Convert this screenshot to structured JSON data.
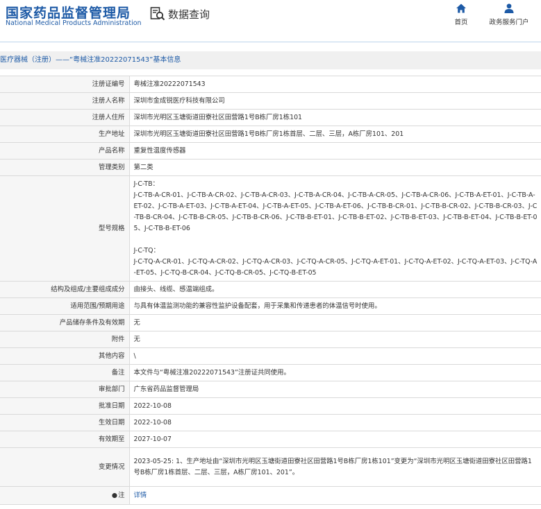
{
  "header": {
    "org_name_cn": "国家药品监督管理局",
    "org_name_en": "National Medical Products Administration",
    "query_label": "数据查询",
    "nav": [
      {
        "label": "首页",
        "icon": "home-icon"
      },
      {
        "label": "政务服务门户",
        "icon": "user-icon"
      }
    ]
  },
  "breadcrumb": "医疗器械（注册）——“粤械注准20222071543”基本信息",
  "colors": {
    "brand": "#1d5aa6",
    "label_bg": "#f6f6f6",
    "border": "#d9d9d9"
  },
  "fields": {
    "reg_no": {
      "label": "注册证编号",
      "value": "粤械注准20222071543"
    },
    "registrant": {
      "label": "注册人名称",
      "value": "深圳市金成锐医疗科技有限公司"
    },
    "registrant_addr": {
      "label": "注册人住所",
      "value": "深圳市光明区玉塘街道田寮社区田营路1号B栋厂房1栋101"
    },
    "prod_addr": {
      "label": "生产地址",
      "value": "深圳市光明区玉塘街道田寮社区田营路1号B栋厂房1栋首层、二层、三层，A栋厂房101、201"
    },
    "product_name": {
      "label": "产品名称",
      "value": "重复性温度传感器"
    },
    "mgmt_class": {
      "label": "管理类别",
      "value": "第二类"
    },
    "model": {
      "label": "型号规格",
      "tb_title": "J-C-TB：",
      "tb_list": "J-C-TB-A-CR-01、J-C-TB-A-CR-02、J-C-TB-A-CR-03、J-C-TB-A-CR-04、J-C-TB-A-CR-05、J-C-TB-A-CR-06、J-C-TB-A-ET-01、J-C-TB-A-ET-02、J-C-TB-A-ET-03、J-C-TB-A-ET-04、J-C-TB-A-ET-05、J-C-TB-A-ET-06、J-C-TB-B-CR-01、J-C-TB-B-CR-02、J-C-TB-B-CR-03、J-C-TB-B-CR-04、J-C-TB-B-CR-05、J-C-TB-B-CR-06、J-C-TB-B-ET-01、J-C-TB-B-ET-02、J-C-TB-B-ET-03、J-C-TB-B-ET-04、J-C-TB-B-ET-05、J-C-TB-B-ET-06",
      "tq_title": "J-C-TQ：",
      "tq_list": "J-C-TQ-A-CR-01、J-C-TQ-A-CR-02、J-C-TQ-A-CR-03、J-C-TQ-A-CR-05、J-C-TQ-A-ET-01、J-C-TQ-A-ET-02、J-C-TQ-A-ET-03、J-C-TQ-A-ET-05、J-C-TQ-B-CR-04、J-C-TQ-B-CR-05、J-C-TQ-B-ET-05"
    },
    "structure": {
      "label": "结构及组成/主要组成成分",
      "value": "由接头、线缆、感温端组成。"
    },
    "scope": {
      "label": "适用范围/预期用途",
      "value": "与具有体温监测功能的兼容性监护设备配套，用于采集和传递患者的体温信号时使用。"
    },
    "storage": {
      "label": "产品储存条件及有效期",
      "value": "无"
    },
    "attachment": {
      "label": "附件",
      "value": "无"
    },
    "other": {
      "label": "其他内容",
      "value": "\\"
    },
    "remark": {
      "label": "备注",
      "value": "本文件与“粤械注准20222071543”注册证共同使用。"
    },
    "dept": {
      "label": "审批部门",
      "value": "广东省药品监督管理局"
    },
    "approve_date": {
      "label": "批准日期",
      "value": "2022-10-08"
    },
    "effective_date": {
      "label": "生效日期",
      "value": "2022-10-08"
    },
    "expire_date": {
      "label": "有效期至",
      "value": "2027-10-07"
    },
    "change": {
      "label": "变更情况",
      "value": "2023-05-25: 1、生产地址由“深圳市光明区玉塘街道田寮社区田营路1号B栋厂房1栋101”变更为“深圳市光明区玉塘街道田寮社区田营路1号B栋厂房1栋首层、二层、三层，A栋厂房101、201”。"
    },
    "note": {
      "label": "注",
      "link": "详情"
    }
  }
}
